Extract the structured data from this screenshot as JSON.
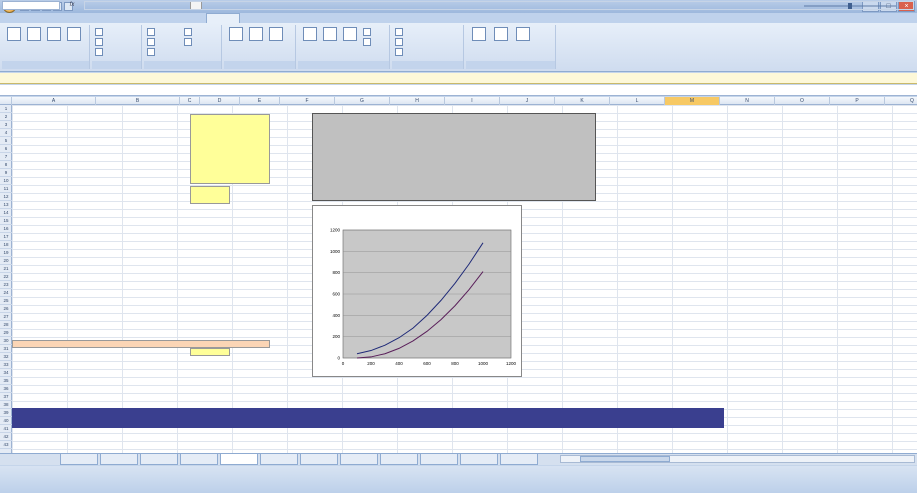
{
  "window": {
    "title": "",
    "controls": [
      "–",
      "□",
      "×"
    ]
  },
  "ribbon": {
    "tabs": [
      "",
      "",
      "",
      "",
      "",
      "",
      "",
      "",
      "",
      ""
    ],
    "active_tab_index": 5,
    "groups": [
      "",
      "",
      "",
      "",
      "",
      "",
      ""
    ]
  },
  "security_bar": {
    "title": "",
    "message": "",
    "options_label": ""
  },
  "formula_bar": {
    "name_box": "",
    "fx": "fx",
    "formula": ""
  },
  "columns": [
    "",
    "A",
    "B",
    "C",
    "D",
    "E",
    "F",
    "G",
    "H",
    "I",
    "J",
    "K",
    "L",
    "M",
    "N",
    "O",
    "P",
    "Q"
  ],
  "selected_column_index": 13,
  "rows": [
    "1",
    "2",
    "3",
    "4",
    "5",
    "6",
    "7",
    "8",
    "9",
    "10",
    "11",
    "12",
    "13",
    "14",
    "15",
    "16",
    "17",
    "18",
    "19",
    "20",
    "21",
    "22",
    "23",
    "24",
    "25",
    "26",
    "27",
    "28",
    "29",
    "30",
    "31",
    "32",
    "33",
    "34",
    "35",
    "36",
    "37",
    "38",
    "39",
    "40",
    "41",
    "42",
    "43"
  ],
  "chart_data": {
    "type": "line",
    "title": "",
    "xlabel": "",
    "ylabel": "",
    "xlim": [
      0,
      1200
    ],
    "ylim": [
      0,
      1200
    ],
    "x_ticks": [
      "0",
      "200",
      "400",
      "600",
      "800",
      "1000",
      "1200"
    ],
    "y_ticks": [
      "0",
      "200",
      "400",
      "600",
      "800",
      "1000",
      "1200"
    ],
    "series": [
      {
        "x": [
          100,
          200,
          300,
          400,
          500,
          600,
          700,
          800,
          900,
          1000
        ],
        "y": [
          40,
          70,
          120,
          190,
          280,
          400,
          540,
          700,
          880,
          1080
        ]
      },
      {
        "x": [
          100,
          200,
          300,
          400,
          500,
          600,
          700,
          800,
          900,
          1000
        ],
        "y": [
          0,
          10,
          40,
          90,
          160,
          250,
          360,
          490,
          640,
          810
        ]
      }
    ],
    "trend_labels": [
      "",
      ""
    ],
    "legend": {
      "placement": "right",
      "entries": [
        "",
        "",
        "",
        ""
      ]
    }
  },
  "sheet_tabs": {
    "tabs": [
      "",
      "",
      "",
      "",
      "",
      "",
      "",
      "",
      "",
      "",
      "",
      ""
    ],
    "active_index": 4
  },
  "status": {
    "ready": ""
  }
}
